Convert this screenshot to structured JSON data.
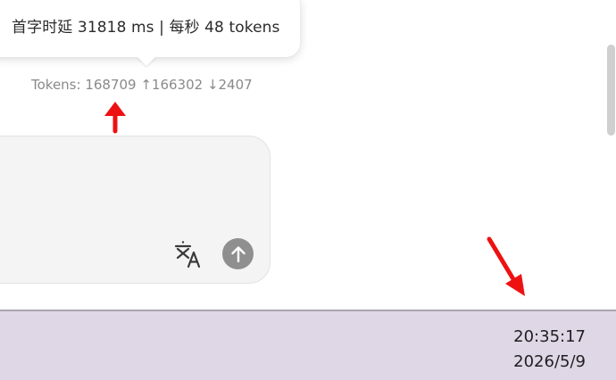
{
  "tooltip": {
    "text": "首字时延 31818 ms | 每秒 48 tokens"
  },
  "token_stats": {
    "text": "Tokens: 168709 ↑166302 ↓2407"
  },
  "input_box": {
    "translate_icon": "translate-icon",
    "send_icon": "arrow-up-icon"
  },
  "taskbar": {
    "time": "20:35:17",
    "date": "2026/5/9"
  },
  "colors": {
    "annotation_arrow": "#ee1111",
    "send_button": "#8f8f8f",
    "taskbar_bg": "#dfd6e6"
  }
}
